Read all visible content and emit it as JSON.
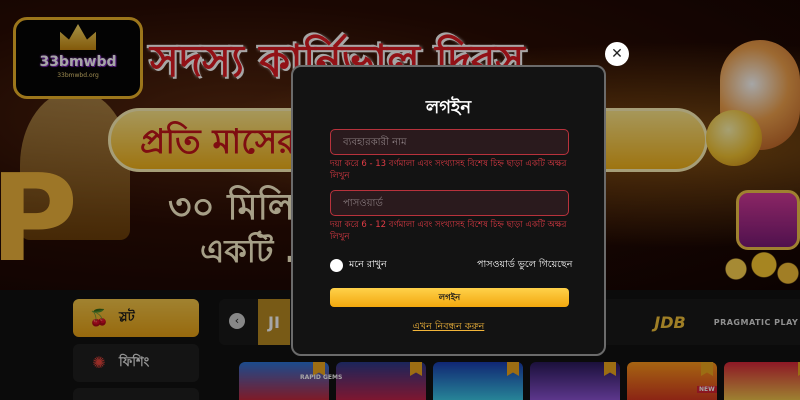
{
  "banner": {
    "title": "সদস্য কার্নিভাল দিবস",
    "ribbon": "প্রতি মাসের ... রিখে",
    "line2": "৩০ মিলিয় ... র",
    "line3": "একটি ..."
  },
  "logo": {
    "name": "33bmwbd",
    "domain": "33bmwbd.org"
  },
  "modal": {
    "title": "লগইন",
    "username_placeholder": "ব্যবহারকারী নাম",
    "username_error": "দয়া করে 6 - 13 বর্ণমালা এবং সংখ্যাসহ বিশেষ চিহ্ন ছাড়া একটি অক্ষর লিখুন",
    "password_placeholder": "পাসওয়ার্ড",
    "password_error": "দয়া করে 6 - 12 বর্ণমালা এবং সংখ্যাসহ বিশেষ চিহ্ন ছাড়া একটি অক্ষর লিখুন",
    "remember_label": "মনে রাখুন",
    "forgot_label": "পাসওয়ার্ড ভুলে গিয়েছেন",
    "login_button": "লগইন",
    "register_link": "এখন নিবন্ধন করুন",
    "close_glyph": "✕"
  },
  "categories": [
    {
      "label": "স্লট",
      "icon": "cherry-icon",
      "active": true
    },
    {
      "label": "ফিশিং",
      "icon": "octopus-icon",
      "active": false
    }
  ],
  "providers": [
    {
      "label": "JDB"
    },
    {
      "label": "PRAGMATIC PLAY"
    }
  ],
  "games": {
    "tag1": "RAPID GEMS",
    "tag2": "NEW"
  },
  "colors": {
    "accent": "#f2a80e",
    "error": "#e03b45",
    "modal_bg": "#131313"
  }
}
